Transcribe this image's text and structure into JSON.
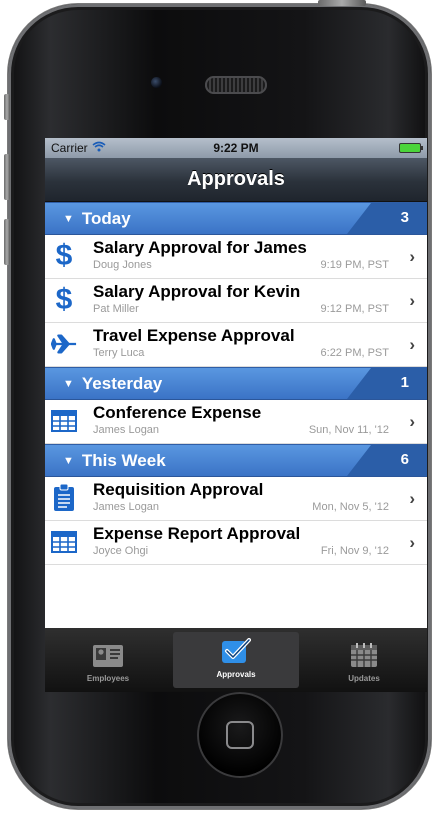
{
  "status": {
    "carrier": "Carrier",
    "time": "9:22 PM"
  },
  "nav": {
    "title": "Approvals"
  },
  "sections": [
    {
      "label": "Today",
      "count": "3",
      "items": [
        {
          "icon": "dollar-icon",
          "title": "Salary Approval for James",
          "sub": "Doug Jones",
          "time": "9:19 PM, PST"
        },
        {
          "icon": "dollar-icon",
          "title": "Salary Approval for Kevin",
          "sub": "Pat Miller",
          "time": "9:12 PM, PST"
        },
        {
          "icon": "airplane-icon",
          "title": "Travel Expense Approval",
          "sub": "Terry Luca",
          "time": "6:22 PM, PST"
        }
      ]
    },
    {
      "label": "Yesterday",
      "count": "1",
      "items": [
        {
          "icon": "table-icon",
          "title": "Conference Expense",
          "sub": "James Logan",
          "time": "Sun, Nov 11, '12"
        }
      ]
    },
    {
      "label": "This Week",
      "count": "6",
      "items": [
        {
          "icon": "clipboard-icon",
          "title": "Requisition Approval",
          "sub": "James Logan",
          "time": "Mon, Nov 5, '12"
        },
        {
          "icon": "table-icon",
          "title": "Expense Report Approval",
          "sub": "Joyce Ohgi",
          "time": "Fri, Nov 9, '12"
        }
      ]
    }
  ],
  "tabs": [
    {
      "label": "Employees",
      "icon": "contact-card-icon"
    },
    {
      "label": "Approvals",
      "icon": "checkmark-icon",
      "active": true
    },
    {
      "label": "Updates",
      "icon": "calendar-icon"
    }
  ],
  "colors": {
    "section": "#3b73c6",
    "accent": "#1c67c8",
    "navbar": "#2b323b"
  }
}
